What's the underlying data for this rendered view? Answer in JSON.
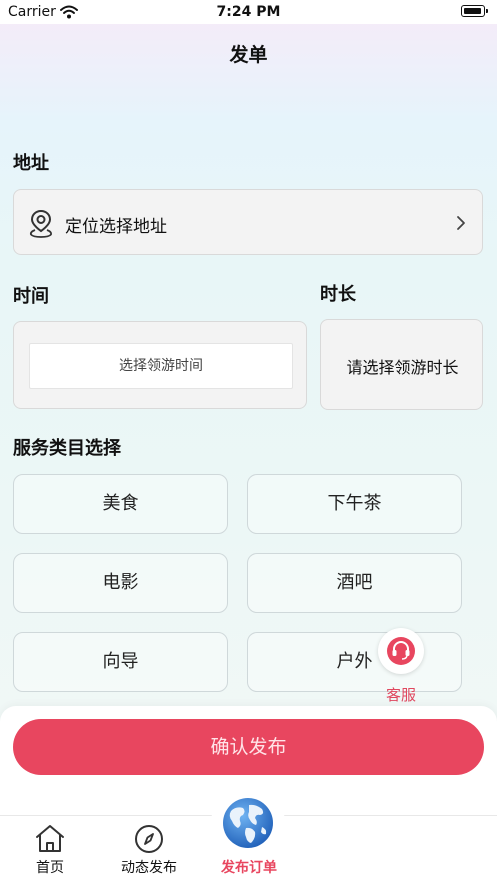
{
  "status_bar": {
    "carrier": "Carrier",
    "time": "7:24 PM"
  },
  "header": {
    "title": "发单"
  },
  "address": {
    "label": "地址",
    "placeholder": "定位选择地址",
    "icon": "location-pin-icon",
    "chevron_icon": "chevron-right-icon"
  },
  "time": {
    "label": "时间",
    "placeholder": "选择领游时间"
  },
  "duration": {
    "label": "时长",
    "placeholder": "请选择领游时长"
  },
  "services": {
    "label": "服务类目选择",
    "items": [
      "美食",
      "下午茶",
      "电影",
      "酒吧",
      "向导",
      "户外"
    ]
  },
  "customer_service": {
    "label": "客服",
    "icon": "headset-icon"
  },
  "confirm": {
    "label": "确认发布",
    "color": "#e8465f"
  },
  "tabs": [
    {
      "label": "首页",
      "icon": "home-icon",
      "active": false
    },
    {
      "label": "动态发布",
      "icon": "compass-icon",
      "active": false
    },
    {
      "label": "发布订单",
      "icon": "globe-icon",
      "active": true
    }
  ],
  "colors": {
    "accent": "#e8465f"
  }
}
